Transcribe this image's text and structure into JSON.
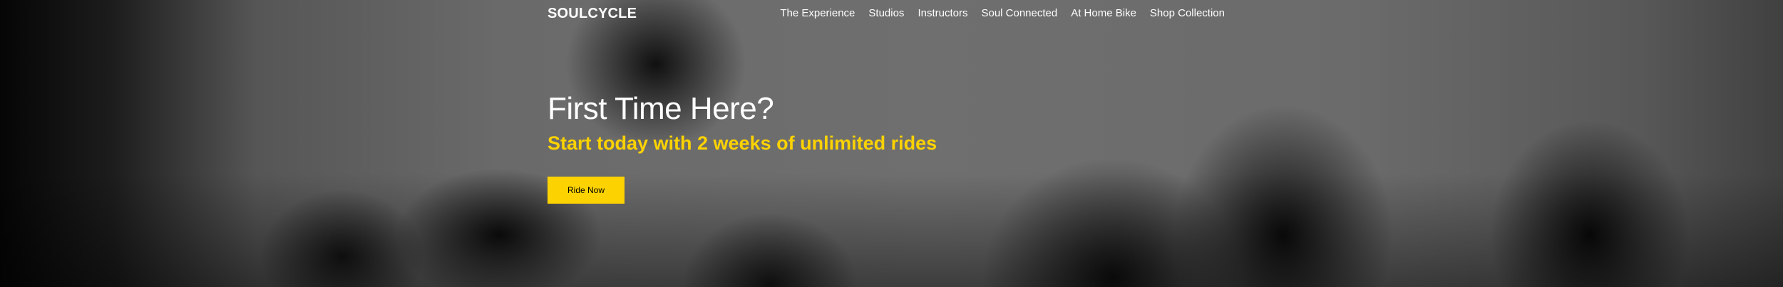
{
  "brand": {
    "name": "SOULCYCLE",
    "accent_color": "#fcd200"
  },
  "nav": {
    "items": [
      {
        "label": "The Experience"
      },
      {
        "label": "Studios"
      },
      {
        "label": "Instructors"
      },
      {
        "label": "Soul Connected"
      },
      {
        "label": "At Home Bike"
      },
      {
        "label": "Shop Collection"
      }
    ]
  },
  "hero": {
    "headline": "First Time Here?",
    "subheadline": "Start today with 2 weeks of unlimited rides",
    "cta_label": "Ride Now",
    "background": "black-and-white photo of indoor cycling riders"
  }
}
